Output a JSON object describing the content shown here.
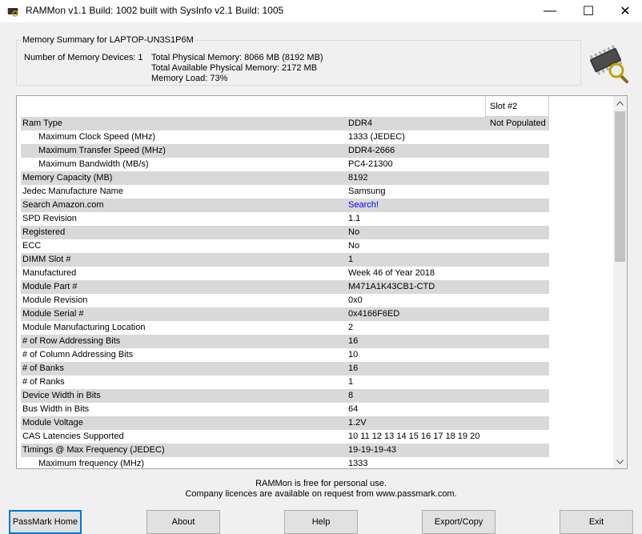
{
  "window": {
    "title": "RAMMon v1.1 Build: 1002 built with SysInfo v2.1 Build: 1005",
    "minimize": "—",
    "maximize": "☐",
    "close": "✕"
  },
  "summary": {
    "legend": "Memory Summary for LAPTOP-UN3S1P6M",
    "devices": "Number of Memory Devices: 1",
    "total_physical": "Total Physical Memory: 8066 MB (8192 MB)",
    "total_available": "Total Available Physical Memory: 2172 MB",
    "memory_load": "Memory Load: 73%"
  },
  "grid": {
    "slot_header": "Slot #2",
    "rows": [
      {
        "label": "Ram Type",
        "value": "DDR4",
        "slot2": "Not Populated",
        "shaded": true,
        "indent": false
      },
      {
        "label": "Maximum Clock Speed (MHz)",
        "value": "1333 (JEDEC)",
        "slot2": "",
        "shaded": false,
        "indent": true
      },
      {
        "label": "Maximum Transfer Speed (MHz)",
        "value": "DDR4-2666",
        "slot2": "",
        "shaded": true,
        "indent": true
      },
      {
        "label": "Maximum Bandwidth (MB/s)",
        "value": "PC4-21300",
        "slot2": "",
        "shaded": false,
        "indent": true
      },
      {
        "label": "Memory Capacity (MB)",
        "value": "8192",
        "slot2": "",
        "shaded": true,
        "indent": false
      },
      {
        "label": "Jedec Manufacture Name",
        "value": "Samsung",
        "slot2": "",
        "shaded": false,
        "indent": false
      },
      {
        "label": "Search Amazon.com",
        "value": "Search!",
        "slot2": "",
        "shaded": true,
        "indent": false,
        "link": true
      },
      {
        "label": "SPD Revision",
        "value": "1.1",
        "slot2": "",
        "shaded": false,
        "indent": false
      },
      {
        "label": "Registered",
        "value": "No",
        "slot2": "",
        "shaded": true,
        "indent": false
      },
      {
        "label": "ECC",
        "value": "No",
        "slot2": "",
        "shaded": false,
        "indent": false
      },
      {
        "label": "DIMM Slot #",
        "value": "1",
        "slot2": "",
        "shaded": true,
        "indent": false
      },
      {
        "label": "Manufactured",
        "value": "Week 46 of Year 2018",
        "slot2": "",
        "shaded": false,
        "indent": false
      },
      {
        "label": "Module Part #",
        "value": "M471A1K43CB1-CTD",
        "slot2": "",
        "shaded": true,
        "indent": false
      },
      {
        "label": "Module Revision",
        "value": "0x0",
        "slot2": "",
        "shaded": false,
        "indent": false
      },
      {
        "label": "Module Serial #",
        "value": "0x4166F6ED",
        "slot2": "",
        "shaded": true,
        "indent": false
      },
      {
        "label": "Module Manufacturing Location",
        "value": "2",
        "slot2": "",
        "shaded": false,
        "indent": false
      },
      {
        "label": "# of Row Addressing Bits",
        "value": "16",
        "slot2": "",
        "shaded": true,
        "indent": false
      },
      {
        "label": "# of Column Addressing Bits",
        "value": "10",
        "slot2": "",
        "shaded": false,
        "indent": false
      },
      {
        "label": "# of Banks",
        "value": "16",
        "slot2": "",
        "shaded": true,
        "indent": false
      },
      {
        "label": "# of Ranks",
        "value": "1",
        "slot2": "",
        "shaded": false,
        "indent": false
      },
      {
        "label": "Device Width in Bits",
        "value": "8",
        "slot2": "",
        "shaded": true,
        "indent": false
      },
      {
        "label": "Bus Width in Bits",
        "value": "64",
        "slot2": "",
        "shaded": false,
        "indent": false
      },
      {
        "label": "Module Voltage",
        "value": "1.2V",
        "slot2": "",
        "shaded": true,
        "indent": false
      },
      {
        "label": "CAS Latencies Supported",
        "value": "10 11 12 13 14 15 16 17 18 19 20",
        "slot2": "",
        "shaded": false,
        "indent": false
      },
      {
        "label": "Timings @ Max Frequency (JEDEC)",
        "value": "19-19-19-43",
        "slot2": "",
        "shaded": true,
        "indent": false
      },
      {
        "label": "Maximum frequency (MHz)",
        "value": "1333",
        "slot2": "",
        "shaded": false,
        "indent": true
      }
    ]
  },
  "footer": {
    "line1": "RAMMon is free for personal use.",
    "line2": "Company licences are available on request from www.passmark.com."
  },
  "buttons": {
    "passmark_home": "PassMark Home",
    "about": "About",
    "help": "Help",
    "export_copy": "Export/Copy",
    "exit": "Exit"
  },
  "colors": {
    "row_shade": "#d9d9d9",
    "link": "#0000ff",
    "default_button_border": "#0078d7"
  }
}
